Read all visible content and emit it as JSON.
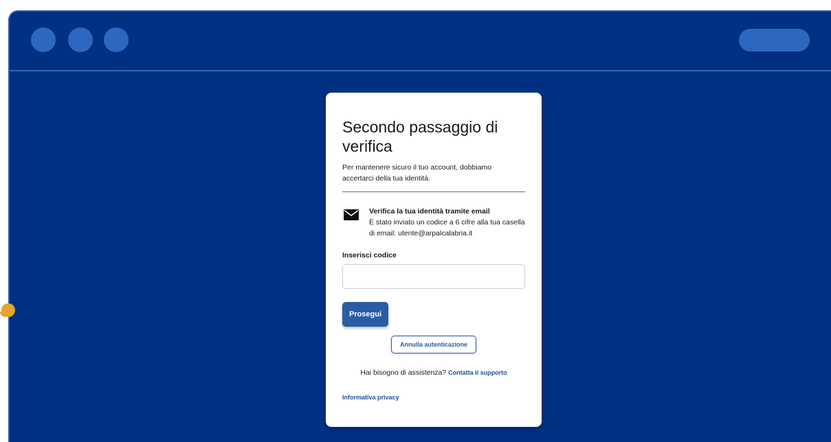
{
  "colors": {
    "window_background": "#003082",
    "window_chrome_accent": "#2c68c0",
    "primary_button": "#2a5ca6",
    "link": "#1f4f9a",
    "handle": "#e3a52e"
  },
  "window": {
    "controls": [
      "window-dot",
      "window-dot",
      "window-dot"
    ],
    "address_pill_icon": "pill-shape"
  },
  "card": {
    "title": "Secondo passaggio di verifica",
    "subtitle": "Per mantenere sicuro il tuo account, dobbiamo accertarci della tua identità.",
    "method": {
      "icon": "envelope-icon",
      "title": "Verifica la tua identità tramite email",
      "description": "È stato inviato un codice a 6 cifre alla tua casella di email: utente@arpalcalabria.it"
    },
    "code_field": {
      "label": "Inserisci codice",
      "value": "",
      "placeholder": ""
    },
    "continue_label": "Prosegui",
    "cancel_label": "Annulla autenticazione",
    "help_text": "Hai bisogno di assistenza?",
    "help_link": "Contatta il supporto",
    "privacy_link": "Informativa privacy"
  }
}
